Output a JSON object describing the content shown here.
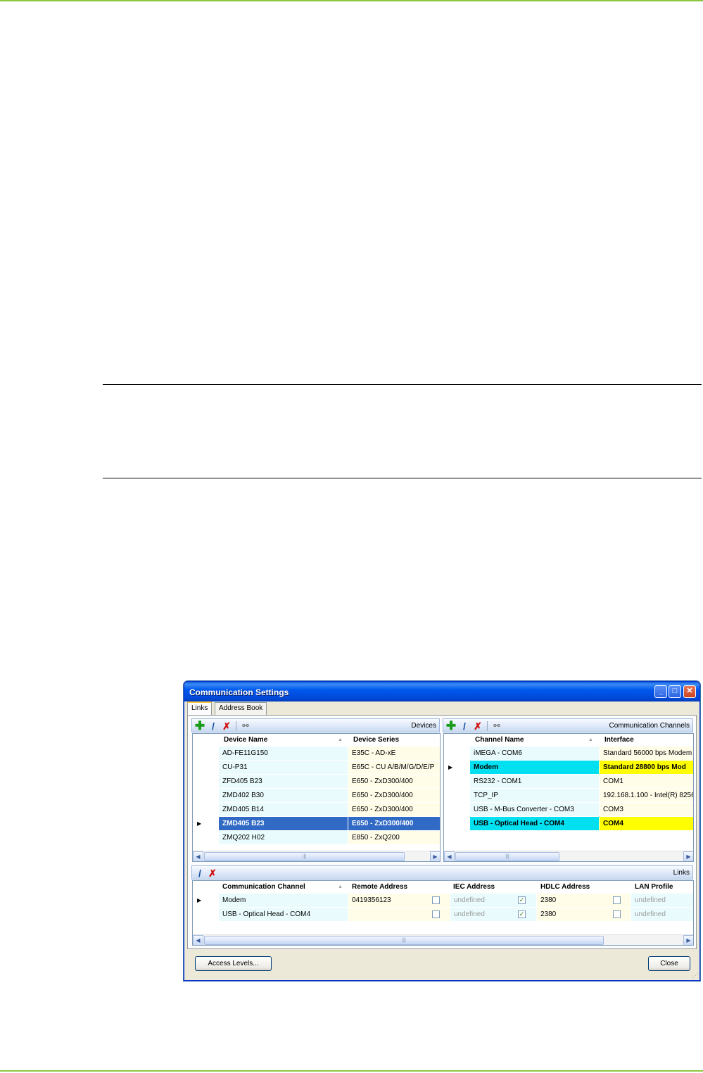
{
  "window": {
    "title": "Communication Settings",
    "min_glyph": "_",
    "max_glyph": "□",
    "close_glyph": "✕"
  },
  "tabs": [
    {
      "label": "Links",
      "active": true
    },
    {
      "label": "Address Book",
      "active": false
    }
  ],
  "devices": {
    "caption": "Devices",
    "columns": [
      "Device Name",
      "Device Series"
    ],
    "rows": [
      {
        "name": "AD-FE11G150",
        "series": "E35C - AD-xE"
      },
      {
        "name": "CU-P31",
        "series": "E65C - CU A/B/M/G/D/E/P"
      },
      {
        "name": "ZFD405 B23",
        "series": "E650 - ZxD300/400"
      },
      {
        "name": "ZMD402 B30",
        "series": "E650 - ZxD300/400"
      },
      {
        "name": "ZMD405 B14",
        "series": "E650 - ZxD300/400"
      },
      {
        "name": "ZMD405 B23",
        "series": "E650 - ZxD300/400",
        "selected": true
      },
      {
        "name": "ZMQ202 H02",
        "series": "E850 - ZxQ200"
      }
    ]
  },
  "channels": {
    "caption": "Communication Channels",
    "columns": [
      "Channel Name",
      "Interface"
    ],
    "rows": [
      {
        "name": "iMEGA - COM6",
        "interface": "Standard 56000 bps Modem"
      },
      {
        "name": "Modem",
        "interface": "Standard 28800 bps Mod",
        "highlight": true,
        "current": true
      },
      {
        "name": "RS232 - COM1",
        "interface": "COM1"
      },
      {
        "name": "TCP_IP",
        "interface": "192.168.1.100 - Intel(R) 8256"
      },
      {
        "name": "USB - M-Bus Converter - COM3",
        "interface": "COM3"
      },
      {
        "name": "USB - Optical Head - COM4",
        "interface": "COM4",
        "highlight": true
      }
    ]
  },
  "links": {
    "caption": "Links",
    "columns": [
      "Communication Channel",
      "Remote Address",
      "IEC Address",
      "HDLC Address",
      "LAN Profile"
    ],
    "rows": [
      {
        "channel": "Modem",
        "remote": "0419356123",
        "iec": "undefined",
        "hdlc_checked": true,
        "hdlc": "2380",
        "lan": "undefined"
      },
      {
        "channel": "USB - Optical Head - COM4",
        "remote": "",
        "iec": "undefined",
        "hdlc_checked": true,
        "hdlc": "2380",
        "lan": "undefined"
      }
    ]
  },
  "icons": {
    "add": "add-icon",
    "edit": "edit-icon",
    "delete": "delete-icon",
    "link": "link-icon"
  },
  "buttons": {
    "access_levels": "Access Levels...",
    "close": "Close"
  },
  "colors": {
    "page_rule": "#8cc63f",
    "selection": "#316ac5",
    "channel_highlight": "#00e0f0",
    "interface_highlight": "#ffff00"
  }
}
